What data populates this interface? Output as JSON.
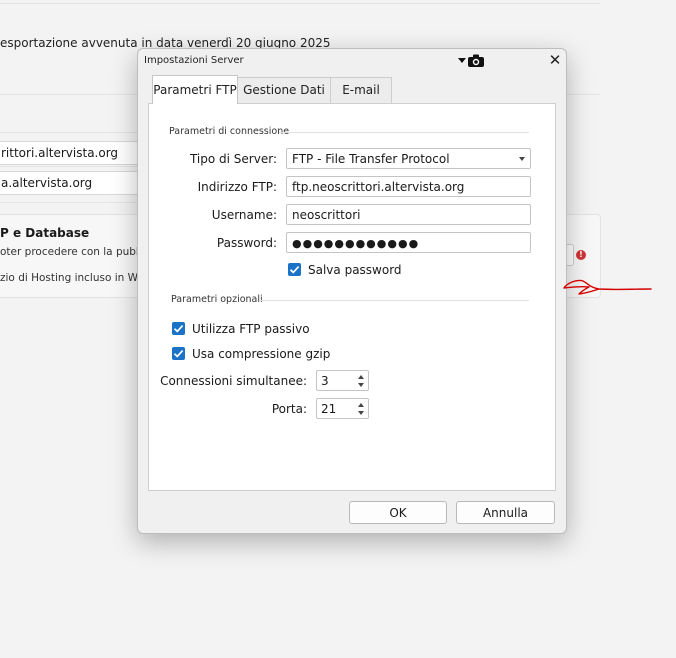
{
  "background": {
    "export_text": "esportazione avvenuta in data venerdì 20 giugno 2025",
    "field_1": "rittori.altervista.org",
    "field_2": "a.altervista.org",
    "card_title": "P e Database",
    "card_subtitle": "oter procedere con la pubblic",
    "card_subtitle_2": "zio di Hosting incluso in WebS"
  },
  "dialog": {
    "title": "Impostazioni Server",
    "tabs": [
      {
        "label": "Parametri FTP",
        "active": true
      },
      {
        "label": "Gestione Dati",
        "active": false
      },
      {
        "label": "E-mail",
        "active": false
      }
    ],
    "connection_group": {
      "title": "Parametri di connessione",
      "server_type_label": "Tipo di Server:",
      "server_type_value": "FTP - File Transfer Protocol",
      "ftp_address_label": "Indirizzo FTP:",
      "ftp_address_value": "ftp.neoscrittori.altervista.org",
      "username_label": "Username:",
      "username_value": "neoscrittori",
      "password_label": "Password:",
      "password_value": "●●●●●●●●●●●●",
      "save_password_label": "Salva password",
      "save_password_checked": true
    },
    "optional_group": {
      "title": "Parametri opzionali",
      "passive_ftp_label": "Utilizza FTP passivo",
      "passive_ftp_checked": true,
      "gzip_label": "Usa compressione gzip",
      "gzip_checked": true,
      "connections_label": "Connessioni simultanee:",
      "connections_value": "3",
      "port_label": "Porta:",
      "port_value": "21"
    },
    "ok_label": "OK",
    "cancel_label": "Annulla"
  },
  "colors": {
    "checkbox_accent": "#1a73c7",
    "annotation_red": "#d40000"
  },
  "icons": [
    "chevron-down-icon",
    "camera-icon",
    "close-icon",
    "checkmark-icon",
    "warning-icon"
  ]
}
